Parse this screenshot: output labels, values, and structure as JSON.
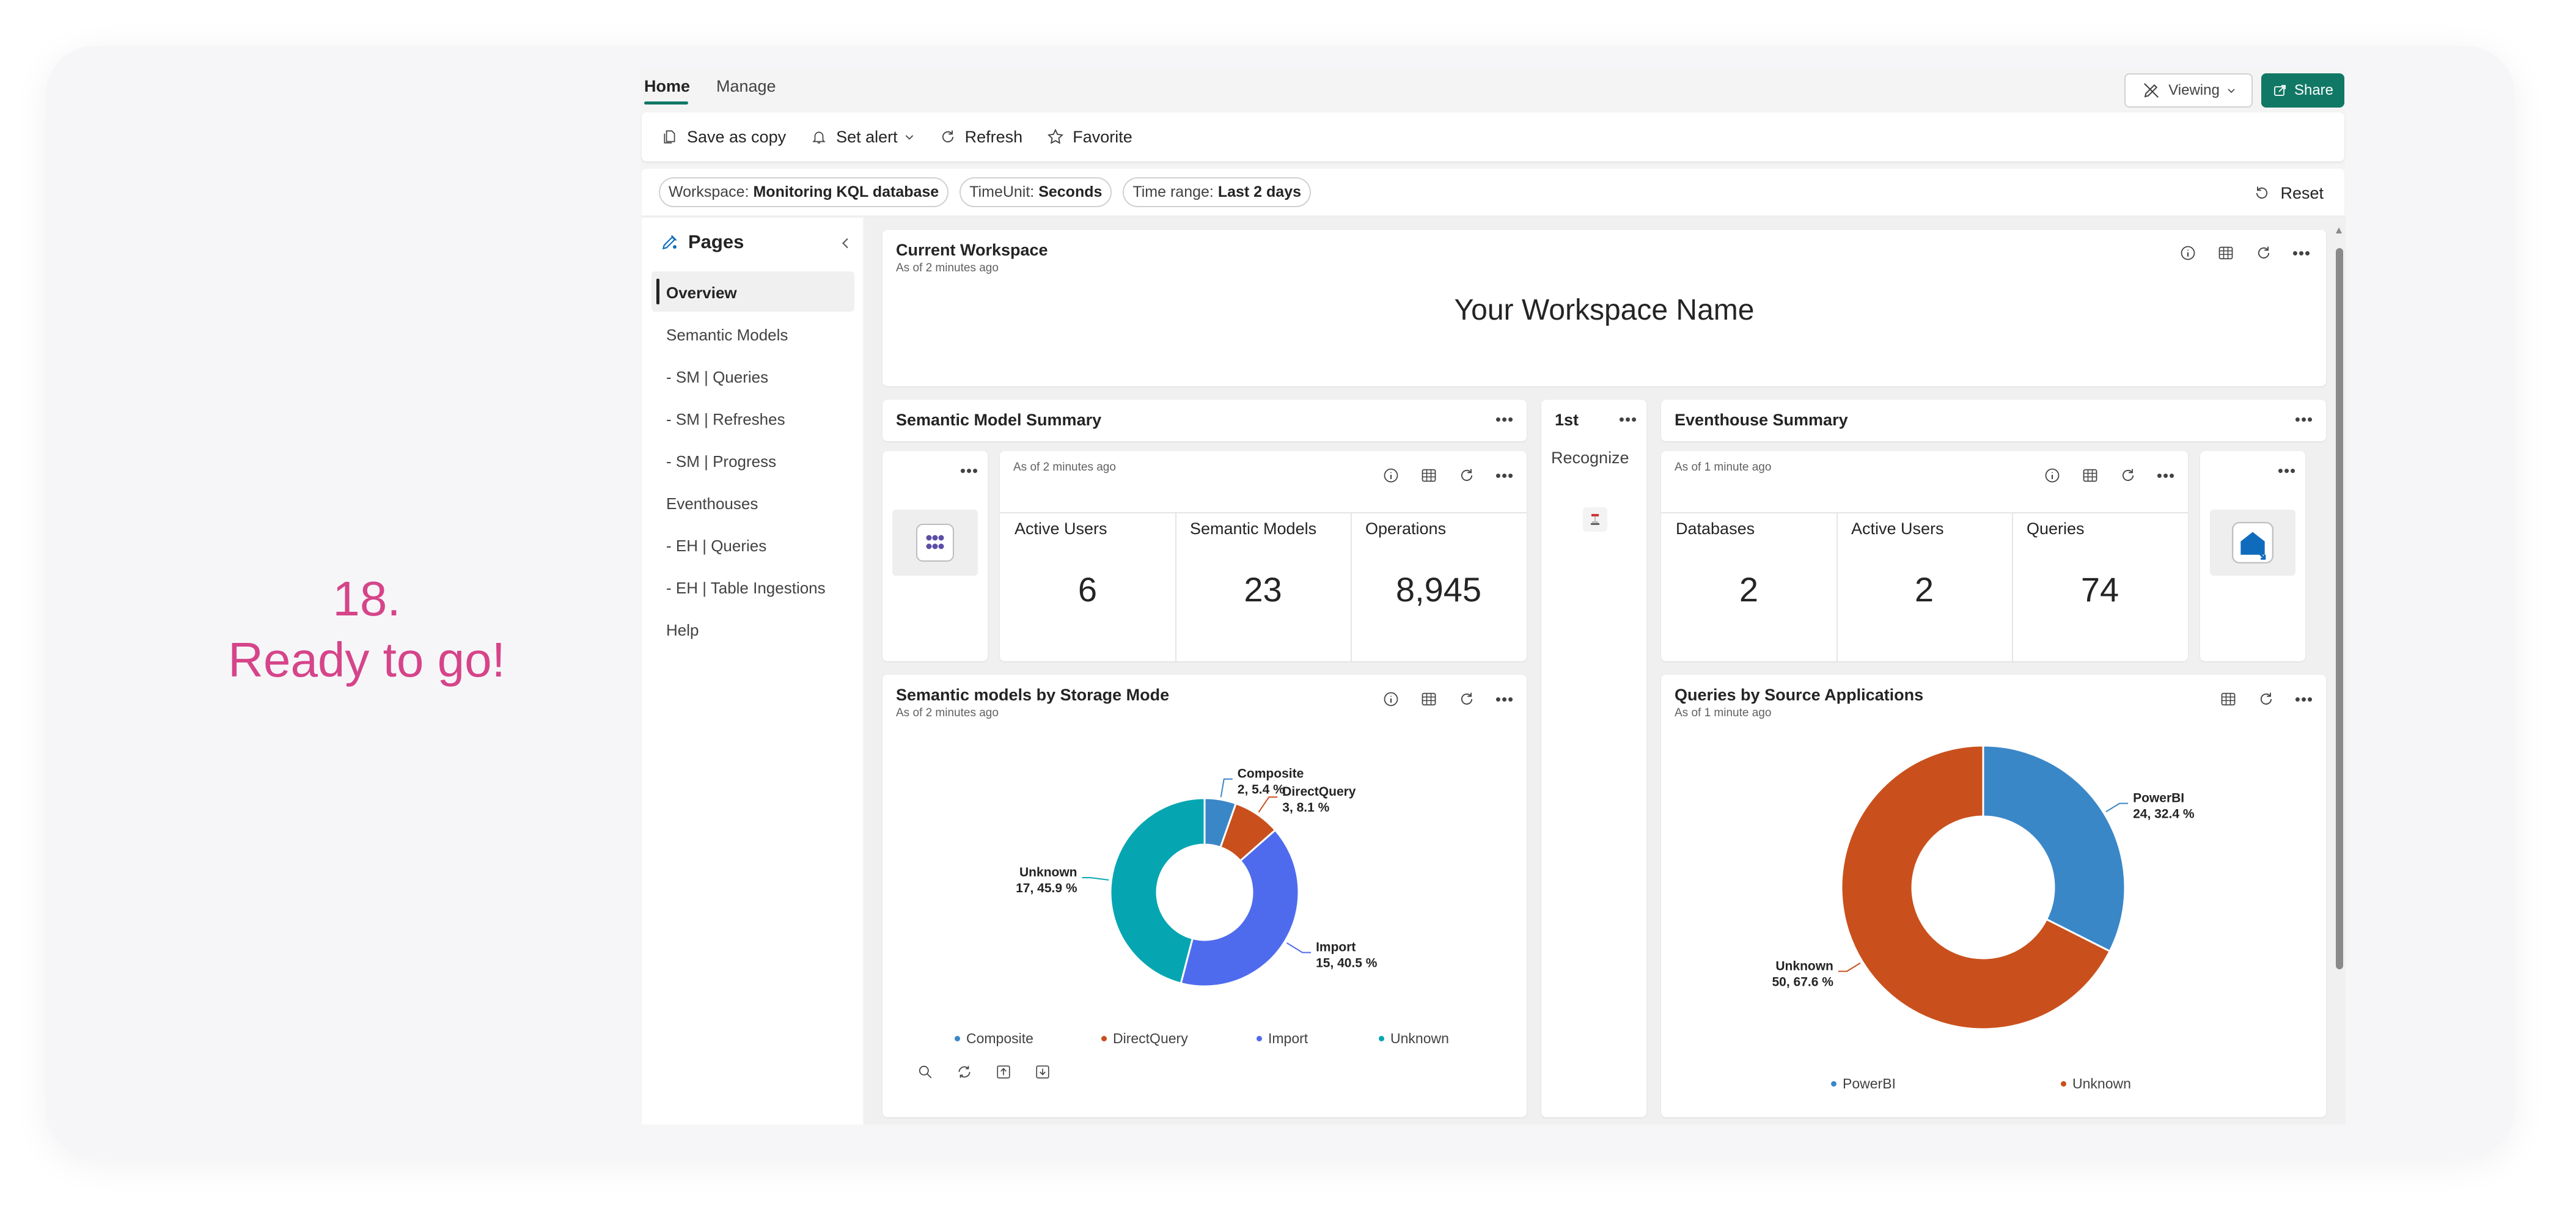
{
  "caption": {
    "step": "18.",
    "text": "Ready to go!"
  },
  "tabs": [
    {
      "label": "Home",
      "active": true
    },
    {
      "label": "Manage",
      "active": false
    }
  ],
  "header": {
    "viewing_label": "Viewing",
    "share_label": "Share"
  },
  "toolbar": {
    "save_copy": "Save as copy",
    "set_alert": "Set alert",
    "refresh": "Refresh",
    "favorite": "Favorite"
  },
  "filters": {
    "workspace_key": "Workspace:",
    "workspace_val": "Monitoring KQL database",
    "timeunit_key": "TimeUnit:",
    "timeunit_val": "Seconds",
    "timerange_key": "Time range:",
    "timerange_val": "Last 2 days",
    "reset": "Reset"
  },
  "sidebar": {
    "title": "Pages",
    "items": [
      {
        "label": "Overview",
        "active": true
      },
      {
        "label": "Semantic Models"
      },
      {
        "label": "- SM | Queries"
      },
      {
        "label": "- SM | Refreshes"
      },
      {
        "label": "- SM | Progress"
      },
      {
        "label": "Eventhouses"
      },
      {
        "label": "- EH | Queries"
      },
      {
        "label": "- EH | Table Ingestions"
      },
      {
        "label": "Help"
      }
    ]
  },
  "current_workspace": {
    "title": "Current Workspace",
    "subtitle": "As of 2 minutes ago",
    "value": "Your Workspace Name"
  },
  "semantic_summary": {
    "title": "Semantic Model Summary",
    "subtitle": "As of 2 minutes ago",
    "kpis": [
      {
        "label": "Active Users",
        "value": "6"
      },
      {
        "label": "Semantic Models",
        "value": "23"
      },
      {
        "label": "Operations",
        "value": "8,945"
      }
    ]
  },
  "rank_card": {
    "title": "1st",
    "label": "Recognize"
  },
  "eventhouse_summary": {
    "title": "Eventhouse Summary",
    "subtitle": "As of 1 minute ago",
    "kpis": [
      {
        "label": "Databases",
        "value": "2"
      },
      {
        "label": "Active Users",
        "value": "2"
      },
      {
        "label": "Queries",
        "value": "74"
      }
    ]
  },
  "storage_chart_card": {
    "title": "Semantic models by Storage Mode",
    "subtitle": "As of 2 minutes ago"
  },
  "source_chart_card": {
    "title": "Queries by Source Applications",
    "subtitle": "As of 1 minute ago"
  },
  "chart_data": [
    {
      "type": "pie",
      "title": "Semantic models by Storage Mode",
      "donut": true,
      "slices": [
        {
          "name": "Composite",
          "value": 2,
          "label": "2, 5.4 %",
          "color": "#3a87c8"
        },
        {
          "name": "DirectQuery",
          "value": 3,
          "label": "3, 8.1 %",
          "color": "#c9501c"
        },
        {
          "name": "Import",
          "value": 15,
          "label": "15, 40.5 %",
          "color": "#4f6bed"
        },
        {
          "name": "Unknown",
          "value": 17,
          "label": "17, 45.9 %",
          "color": "#05a6b1"
        }
      ],
      "legend_position": "bottom"
    },
    {
      "type": "pie",
      "title": "Queries by Source Applications",
      "donut": true,
      "slices": [
        {
          "name": "PowerBI",
          "value": 24,
          "label": "24, 32.4 %",
          "color": "#3a87c8"
        },
        {
          "name": "Unknown",
          "value": 50,
          "label": "50, 67.6 %",
          "color": "#c9501c"
        }
      ],
      "legend_position": "bottom"
    }
  ],
  "colors": {
    "accent": "#117865",
    "caption": "#d6448a"
  }
}
